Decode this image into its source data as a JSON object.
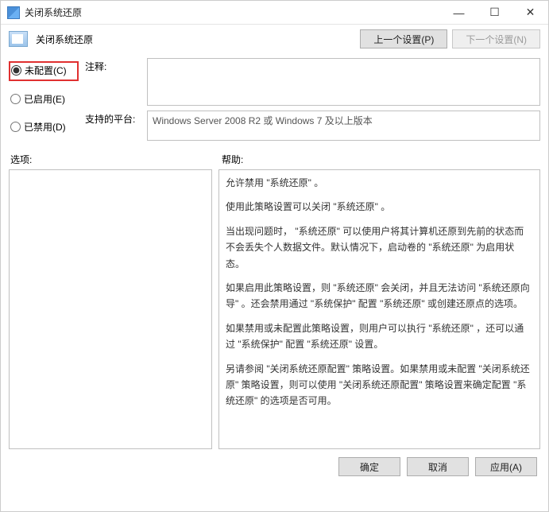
{
  "window": {
    "title": "关闭系统还原"
  },
  "header": {
    "title": "关闭系统还原",
    "prev_btn": "上一个设置(P)",
    "next_btn": "下一个设置(N)"
  },
  "radios": {
    "not_configured": "未配置(C)",
    "enabled": "已启用(E)",
    "disabled": "已禁用(D)",
    "selected": "not_configured"
  },
  "fields": {
    "comment_label": "注释:",
    "comment_value": "",
    "platform_label": "支持的平台:",
    "platform_value": "Windows Server 2008 R2 或 Windows 7 及以上版本"
  },
  "options_label": "选项:",
  "help_label": "帮助:",
  "help_text": [
    "允许禁用 \"系统还原\" 。",
    "使用此策略设置可以关闭 \"系统还原\" 。",
    "当出现问题时， \"系统还原\" 可以使用户将其计算机还原到先前的状态而不会丢失个人数据文件。默认情况下，启动卷的 \"系统还原\" 为启用状态。",
    "如果启用此策略设置，则 \"系统还原\" 会关闭，并且无法访问 \"系统还原向导\" 。还会禁用通过 \"系统保护\" 配置 \"系统还原\" 或创建还原点的选项。",
    "如果禁用或未配置此策略设置，则用户可以执行 \"系统还原\" ，还可以通过 \"系统保护\" 配置 \"系统还原\" 设置。",
    "另请参阅 \"关闭系统还原配置\" 策略设置。如果禁用或未配置 \"关闭系统还原\" 策略设置，则可以使用 \"关闭系统还原配置\" 策略设置来确定配置 \"系统还原\" 的选项是否可用。"
  ],
  "footer": {
    "ok": "确定",
    "cancel": "取消",
    "apply": "应用(A)"
  }
}
